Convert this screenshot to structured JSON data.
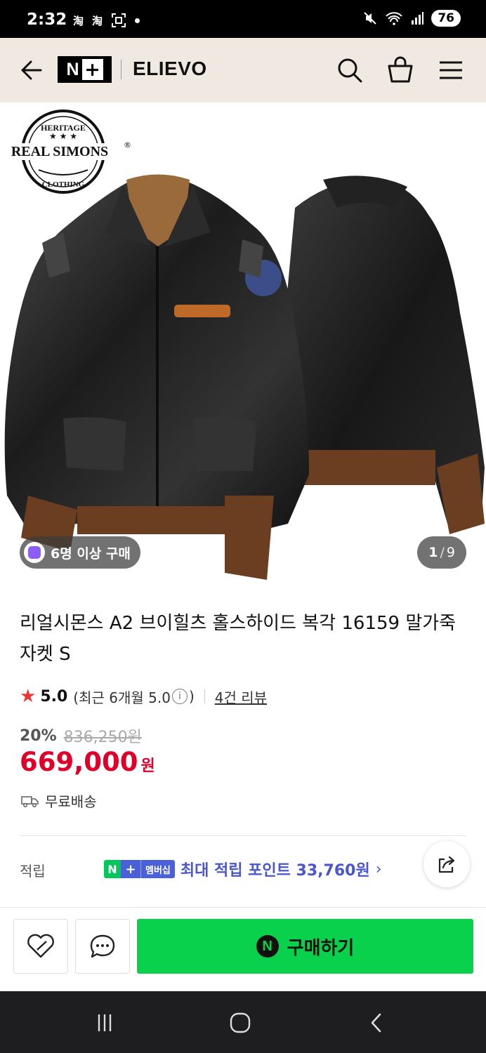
{
  "status_bar": {
    "time": "2:32",
    "notif_icons": [
      "taobao-icon",
      "taobao-icon",
      "screenshot-icon"
    ],
    "battery": "76"
  },
  "header": {
    "brand_badge": "N+",
    "store_name": "ELIEVO",
    "icons": [
      "back-icon",
      "search-icon",
      "cart-icon",
      "menu-icon"
    ]
  },
  "product": {
    "logo": {
      "top_text": "HERITAGE",
      "main_text": "REAL SIMONS",
      "bottom_text": "CLOTHING",
      "registered": "®"
    },
    "buyers_badge": "6명 이상 구매",
    "page_current": "1",
    "page_total": "9",
    "title": "리얼시몬스 A2 브이힐츠 홀스하이드 복각 16159 말가죽자켓 S",
    "rating": "5.0",
    "rating_recent_prefix": "(최근 6개월 5.0",
    "rating_recent_suffix": ")",
    "review_count": "4건 리뷰",
    "discount": "20%",
    "original_price": "836,250원",
    "price": "669,000",
    "price_unit": "원",
    "shipping": "무료배송",
    "points_label": "적립",
    "membership_badge_n": "N",
    "membership_badge_plus": "+",
    "membership_badge_text": "멤버십",
    "points_text": "최대 적립 포인트 33,760원",
    "points_chevron": "›"
  },
  "bottom_bar": {
    "buy_label": "구매하기",
    "buy_n": "N"
  },
  "colors": {
    "header_bg": "#efe9e1",
    "price_red": "#e0002a",
    "buy_green": "#09d14b",
    "points_blue": "#4a55d0",
    "badge_purple": "#8b5cf6",
    "star_red": "#e53935"
  }
}
